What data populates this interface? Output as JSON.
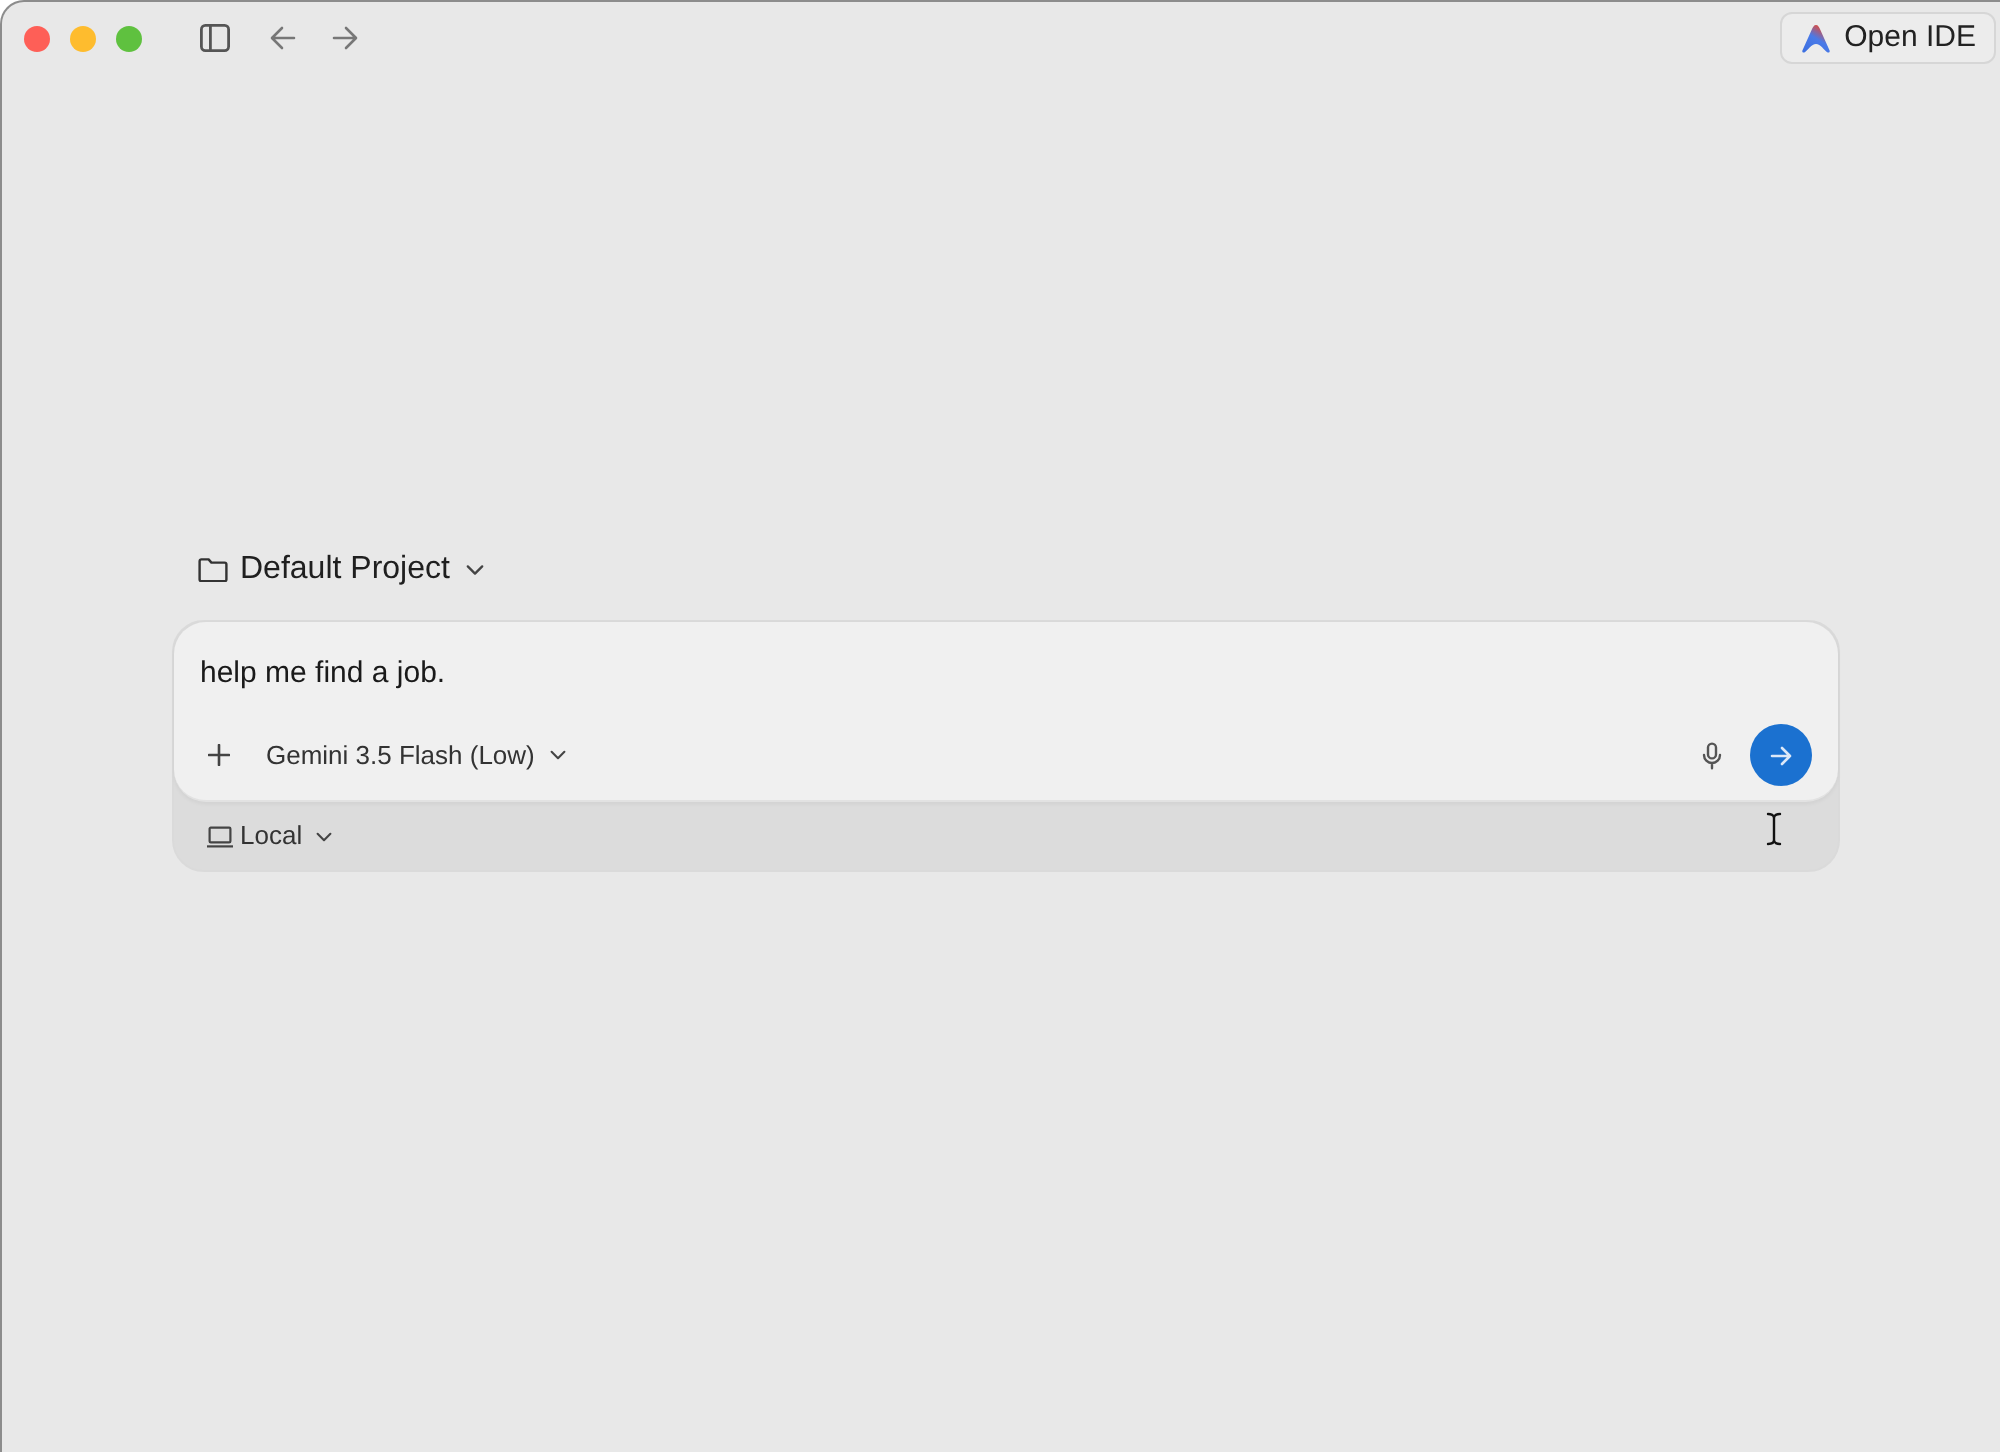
{
  "toolbar": {
    "open_ide_button": {
      "label": "Open IDE"
    }
  },
  "project_selector": {
    "label": "Default Project"
  },
  "composer": {
    "prompt": {
      "value": "help me find a job."
    },
    "model_selector": {
      "label": "Gemini 3.5 Flash (Low)"
    },
    "environment_selector": {
      "label": "Local"
    }
  }
}
